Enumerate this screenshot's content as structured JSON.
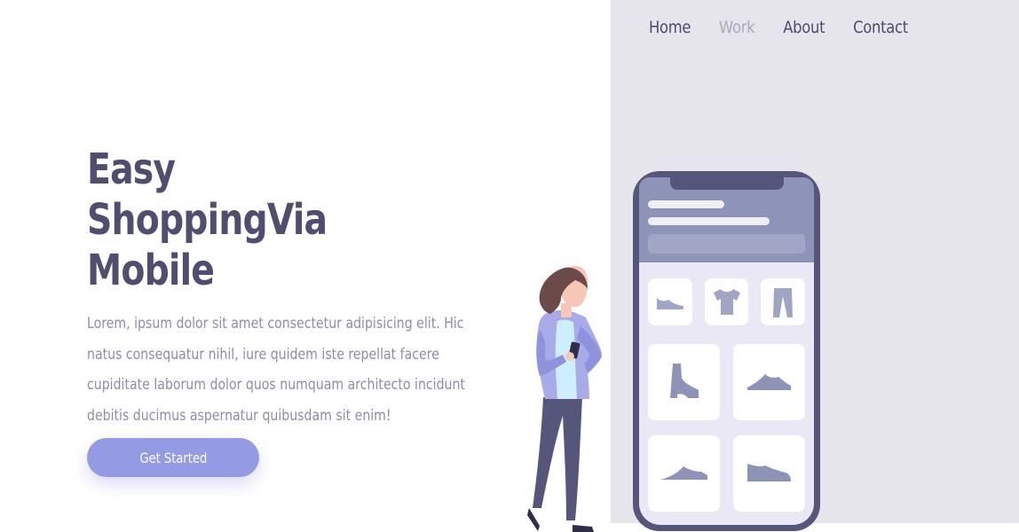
{
  "nav": {
    "items": [
      {
        "label": "Home",
        "active": false
      },
      {
        "label": "Work",
        "active": true
      },
      {
        "label": "About",
        "active": false
      },
      {
        "label": "Contact",
        "active": false
      }
    ]
  },
  "hero": {
    "title_lines": [
      "Easy",
      "ShoppingVia",
      "Mobile"
    ],
    "description": "Lorem, ipsum dolor sit amet consectetur adipisicing elit. Hic natus consequatur nihil, iure quidem iste repellat facere cupiditate laborum dolor quos numquam architecto incidunt debitis ducimus aspernatur quibusdam sit enim!",
    "cta_label": "Get Started"
  },
  "colors": {
    "panel_bg": "#e6e5ec",
    "accent": "#959be3",
    "text_dark": "#4f4e70",
    "text_muted": "#8e8da4",
    "phone_frame": "#56557a"
  },
  "illustration": {
    "phone_items": [
      "flat-shoe-icon",
      "tshirt-icon",
      "pants-icon",
      "boot-icon",
      "sneaker-icon",
      "sneaker-icon",
      "sneaker-icon"
    ],
    "person": "woman-with-phone-figure"
  }
}
